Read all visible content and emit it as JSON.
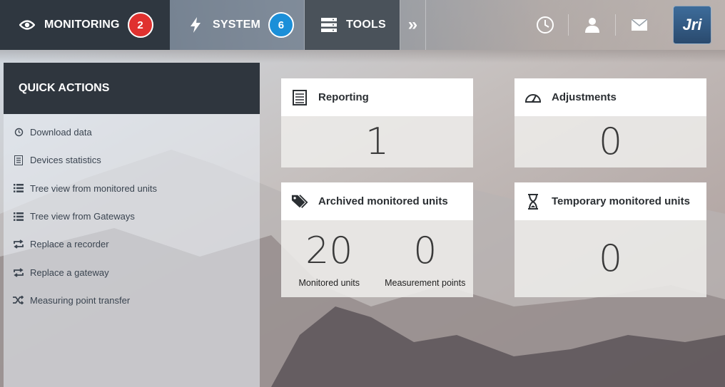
{
  "nav": {
    "monitoring": {
      "label": "MONITORING",
      "badge": "2"
    },
    "system": {
      "label": "SYSTEM",
      "badge": "6"
    },
    "tools": {
      "label": "TOOLS"
    },
    "more_glyph": "»",
    "logo_text": "Jri",
    "right_icons": [
      "clock-icon",
      "user-icon",
      "mail-icon"
    ]
  },
  "sidebar": {
    "title": "QUICK ACTIONS",
    "items": [
      {
        "label": "Download data",
        "icon": "download-clock-icon"
      },
      {
        "label": "Devices statistics",
        "icon": "list-document-icon"
      },
      {
        "label": "Tree view from monitored units",
        "icon": "tree-list-icon"
      },
      {
        "label": "Tree view from Gateways",
        "icon": "tree-list-icon"
      },
      {
        "label": "Replace a recorder",
        "icon": "swap-icon"
      },
      {
        "label": "Replace a gateway",
        "icon": "swap-icon"
      },
      {
        "label": "Measuring point transfer",
        "icon": "shuffle-icon"
      }
    ]
  },
  "cards": {
    "reporting": {
      "title": "Reporting",
      "value": "1"
    },
    "adjustments": {
      "title": "Adjustments",
      "value": "0"
    },
    "archived": {
      "title": "Archived monitored units",
      "monitored_value": "20",
      "monitored_label": "Monitored units",
      "measurement_value": "0",
      "measurement_label": "Measurement points"
    },
    "temporary": {
      "title": "Temporary monitored units",
      "value": "0"
    }
  },
  "colors": {
    "badge_red": "#e0312f",
    "badge_blue": "#1b8fd8",
    "dark": "#2f3740"
  }
}
